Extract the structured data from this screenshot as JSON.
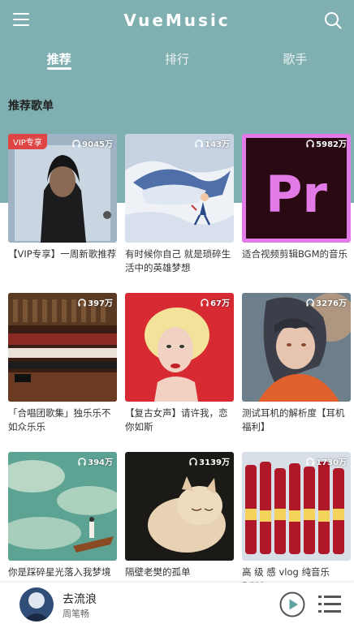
{
  "app": {
    "title": "VueMusic"
  },
  "tabs": [
    {
      "label": "推荐",
      "active": true
    },
    {
      "label": "排行",
      "active": false
    },
    {
      "label": "歌手",
      "active": false
    }
  ],
  "section": {
    "title": "推荐歌单"
  },
  "playlists": [
    {
      "name": "【VIP专享】一周新歌推荐",
      "plays": "9045万",
      "badge": "VIP专享"
    },
    {
      "name": "有时候你自己 就是琐碎生活中的英雄梦想",
      "plays": "143万"
    },
    {
      "name": "适合视频剪辑BGM的音乐",
      "plays": "5982万"
    },
    {
      "name": "「合唱团歌集」独乐乐不如众乐乐",
      "plays": "397万"
    },
    {
      "name": "【复古女声】请许我，恋你如斯",
      "plays": "67万"
    },
    {
      "name": "测试耳机的解析度【耳机福利】",
      "plays": "3276万"
    },
    {
      "name": "你是踩碎星光落入我梦境",
      "plays": "394万"
    },
    {
      "name": "隔壁老樊的孤单",
      "plays": "3139万"
    },
    {
      "name": "高 级 感 vlog 纯音乐 BGM",
      "plays": "1730万"
    }
  ],
  "player": {
    "song": "去流浪",
    "artist": "周笔畅"
  },
  "colors": {
    "header_bg": "#7fafb0",
    "accent": "#5fa3a0",
    "vip_badge": "#e04545"
  }
}
